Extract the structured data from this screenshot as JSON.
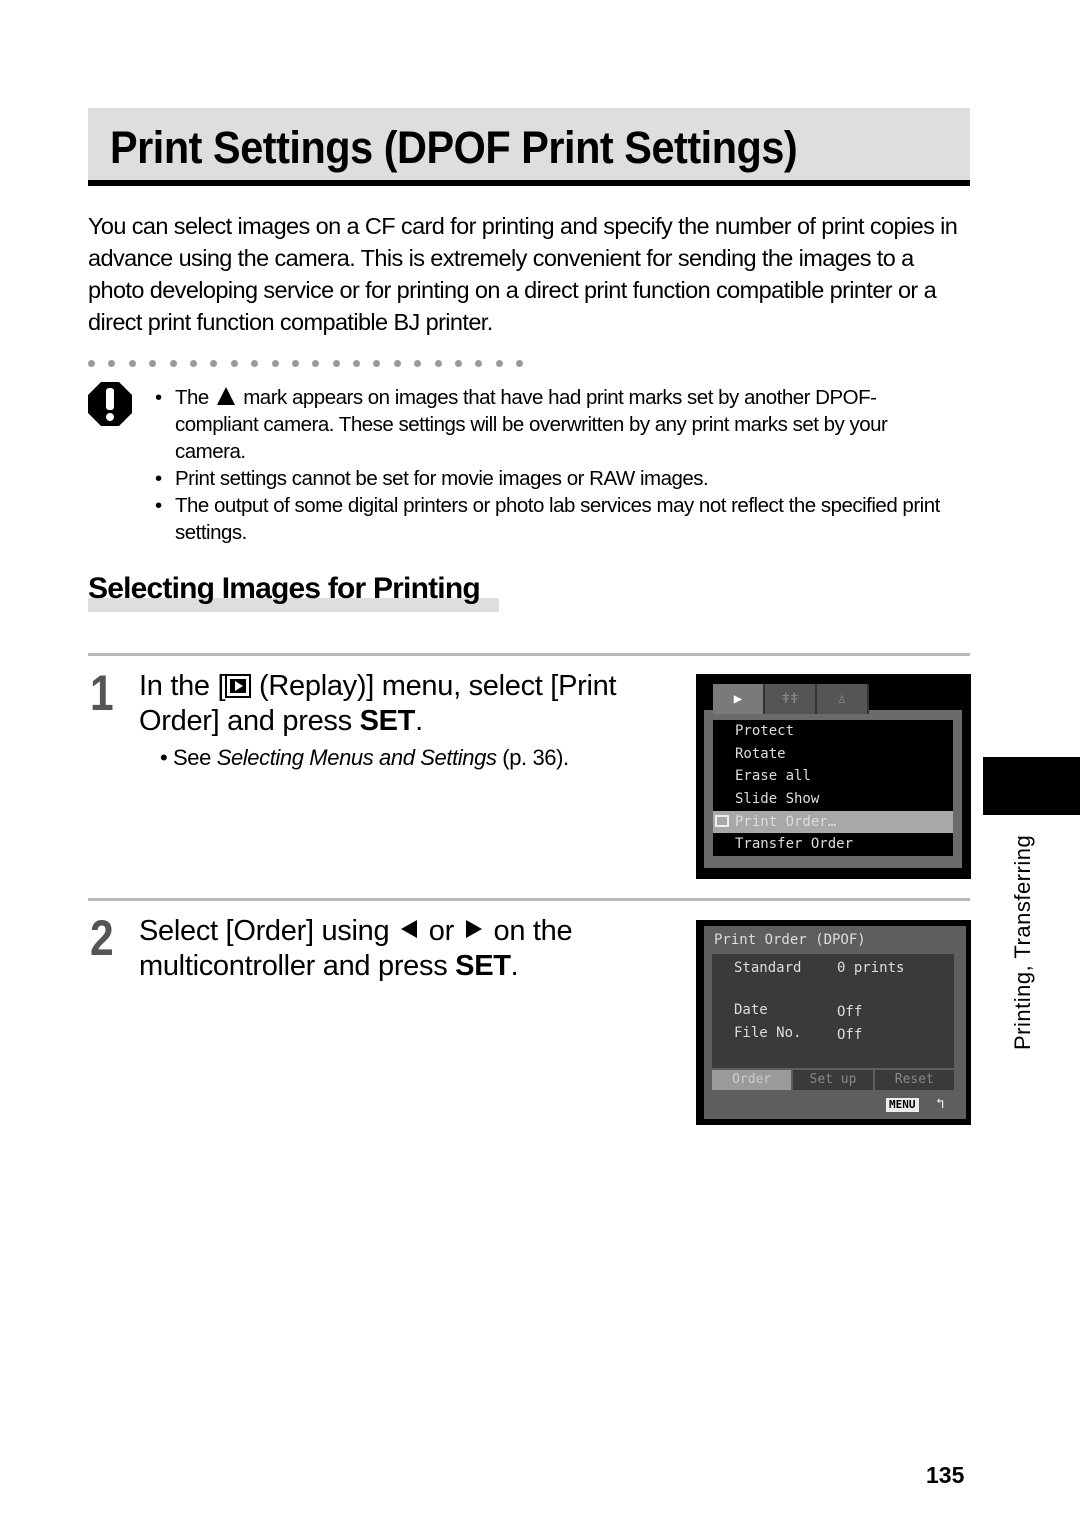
{
  "page": {
    "title": "Print Settings (DPOF Print Settings)",
    "intro": "You can select images on a CF card for printing and specify the number of print copies in advance using the camera. This is extremely convenient for sending the images to a photo developing service or for printing on a direct print function compatible printer or a direct print function compatible BJ printer.",
    "caution_icon": "caution-icon",
    "notes": [
      {
        "before": "The",
        "icon": "warning-triangle-icon",
        "after": "mark appears on images that have had print marks set by another DPOF-compliant camera. These settings will be overwritten by any print marks set by your camera."
      },
      {
        "text": "Print settings cannot be set for movie images or RAW images."
      },
      {
        "text": "The output of some digital printers or photo lab services may not reflect the specified print settings."
      }
    ],
    "section_heading": "Selecting Images for Printing",
    "steps": [
      {
        "number": "1",
        "text_before": "In the [",
        "icon": "replay-icon",
        "text_middle": " (Replay)] menu, select [Print Order] and press ",
        "bold": "SET",
        "text_after": ".",
        "note_prefix": "See ",
        "note_italic": "Selecting Menus and Settings",
        "note_suffix": " (p. 36)."
      },
      {
        "number": "2",
        "text_before": "Select [Order] using ",
        "icon_left": "left-arrow-icon",
        "text_or": " or ",
        "icon_right": "right-arrow-icon",
        "text_middle": " on the multicontroller and press ",
        "bold": "SET",
        "text_after": "."
      }
    ],
    "chapter_label": "Printing, Transferring",
    "page_number": "135"
  },
  "screen1": {
    "tabs": [
      "replay-tab",
      "setup-tab",
      "my-camera-tab"
    ],
    "items": [
      "Protect",
      "Rotate",
      "Erase all",
      "Slide Show",
      "Print Order…",
      "Transfer Order"
    ],
    "selected_index": 4
  },
  "screen2": {
    "header": "Print Order (DPOF)",
    "type_label": "Standard",
    "type_value": "0 prints",
    "date_label": "Date",
    "date_value": "Off",
    "fileno_label": "File No.",
    "fileno_value": "Off",
    "buttons": [
      "Order",
      "Set up",
      "Reset"
    ],
    "selected_button": 0,
    "menu_label": "MENU"
  }
}
